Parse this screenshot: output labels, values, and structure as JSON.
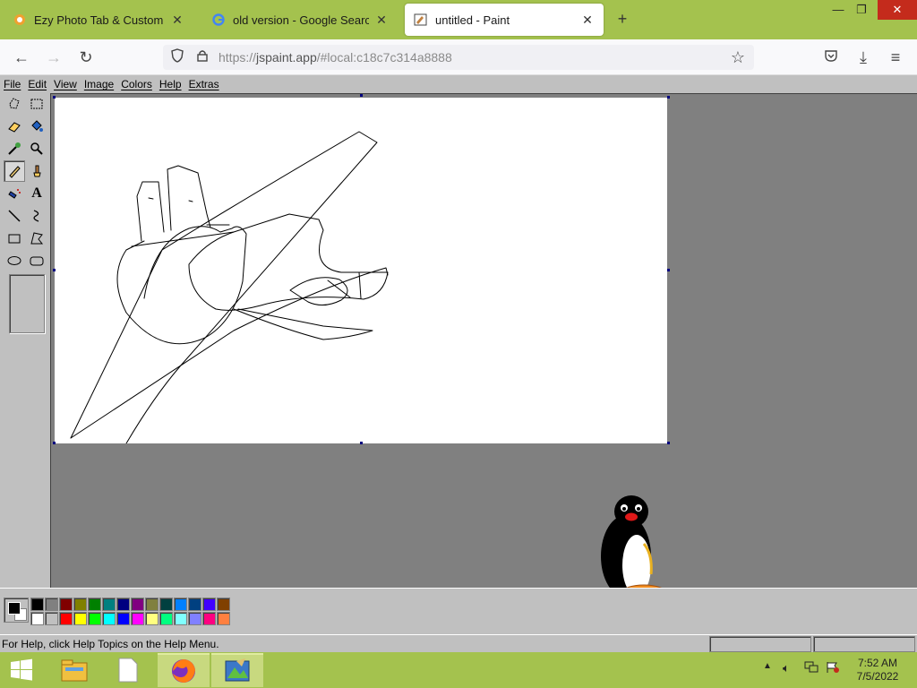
{
  "browser": {
    "tabs": [
      {
        "label": "Ezy Photo Tab & Custom Web",
        "favicon": "photo-tab-icon",
        "active": false
      },
      {
        "label": "old version - Google Search",
        "favicon": "google-icon",
        "active": false
      },
      {
        "label": "untitled - Paint",
        "favicon": "paint-icon",
        "active": true
      }
    ],
    "new_tab_label": "+",
    "url_prefix": "https://",
    "url_host": "jspaint.app",
    "url_rest": "/#local:c18c7c314a8888"
  },
  "paint": {
    "menu": [
      "File",
      "Edit",
      "View",
      "Image",
      "Colors",
      "Help",
      "Extras"
    ],
    "tools": [
      "free-form-select-icon",
      "select-icon",
      "eraser-icon",
      "fill-icon",
      "pick-color-icon",
      "magnifier-icon",
      "pencil-icon",
      "brush-icon",
      "airbrush-icon",
      "text-icon",
      "line-icon",
      "curve-icon",
      "rectangle-icon",
      "polygon-icon",
      "ellipse-icon",
      "rounded-rectangle-icon"
    ],
    "selected_tool": "pencil-icon",
    "palette_top": [
      "#000000",
      "#808080",
      "#800000",
      "#808000",
      "#008000",
      "#008080",
      "#000080",
      "#800080",
      "#808040",
      "#004040",
      "#0080ff",
      "#004080",
      "#4000ff",
      "#804000"
    ],
    "palette_bottom": [
      "#ffffff",
      "#c0c0c0",
      "#ff0000",
      "#ffff00",
      "#00ff00",
      "#00ffff",
      "#0000ff",
      "#ff00ff",
      "#ffff80",
      "#00ff80",
      "#80ffff",
      "#8080ff",
      "#ff0080",
      "#ff8040"
    ],
    "foreground_color": "#000000",
    "background_color": "#ffffff",
    "status_text": "For Help, click Help Topics on the Help Menu."
  },
  "taskbar": {
    "apps": [
      "start-icon",
      "file-explorer-icon",
      "document-icon",
      "firefox-icon",
      "paint-app-icon"
    ],
    "clock_time": "7:52 AM",
    "clock_date": "7/5/2022"
  },
  "colors": {
    "accent_green": "#a4c24e",
    "win_close_red": "#c42b1c",
    "paint_gray": "#c0c0c0",
    "workspace_gray": "#808080"
  }
}
